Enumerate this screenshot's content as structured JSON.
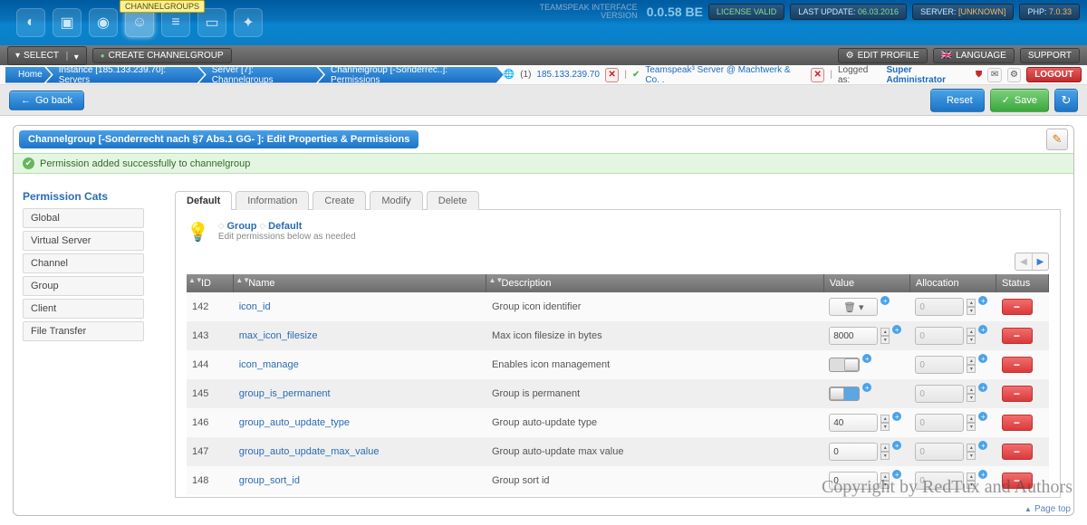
{
  "header": {
    "tooltip": "CHANNELGROUPS",
    "version_label": "TEAMSPEAK INTERFACE\nVERSION",
    "version": "0.0.58 BE",
    "chips": {
      "license": "LICENSE VALID",
      "lastupdate_label": "LAST UPDATE:",
      "lastupdate_value": "06.03.2016",
      "server_label": "SERVER:",
      "server_value": "[UNKNOWN]",
      "php_label": "PHP:",
      "php_value": "7.0.33"
    }
  },
  "secondbar": {
    "select": "SELECT",
    "create_cg": "CREATE CHANNELGROUP",
    "edit_profile": "EDIT PROFILE",
    "language": "LANGUAGE",
    "support": "SUPPORT"
  },
  "breadcrumbs": [
    "Home",
    "Instance [185.133.239.70]: Servers",
    "Server [7]: Channelgroups",
    "Channelgroup [-Sonderrec..]: Permissions"
  ],
  "bc_right": {
    "instance_count": "(1)",
    "instance_ip": "185.133.239.70",
    "server_name": "Teamspeak³ Server @ Machtwerk & Co. .",
    "logged_label": "Logged as:",
    "logged_user": "Super Administrator",
    "logout": "LOGOUT"
  },
  "actionbar": {
    "goback": "Go back",
    "reset": "Reset",
    "save": "Save"
  },
  "card": {
    "title": "Channelgroup [-Sonderrecht nach §7 Abs.1 GG- ]: Edit Properties & Permissions",
    "success": "Permission added successfully to channelgroup"
  },
  "cats": {
    "title": "Permission Cats",
    "items": [
      "Global",
      "Virtual Server",
      "Channel",
      "Group",
      "Client",
      "File Transfer"
    ]
  },
  "tabs": [
    "Default",
    "Information",
    "Create",
    "Modify",
    "Delete"
  ],
  "hint": {
    "title_a": "Group",
    "title_b": "Default",
    "sub": "Edit permissions below as needed"
  },
  "table": {
    "headers": {
      "id": "ID",
      "name": "Name",
      "desc": "Description",
      "value": "Value",
      "alloc": "Allocation",
      "status": "Status"
    },
    "rows": [
      {
        "id": "142",
        "name": "icon_id",
        "desc": "Group icon identifier",
        "vtype": "icon",
        "value": "",
        "alloc": "0"
      },
      {
        "id": "143",
        "name": "max_icon_filesize",
        "desc": "Max icon filesize in bytes",
        "vtype": "num",
        "value": "8000",
        "alloc": "0"
      },
      {
        "id": "144",
        "name": "icon_manage",
        "desc": "Enables icon management",
        "vtype": "toggle",
        "value": "off",
        "alloc": "0"
      },
      {
        "id": "145",
        "name": "group_is_permanent",
        "desc": "Group is permanent",
        "vtype": "toggle",
        "value": "on",
        "alloc": "0"
      },
      {
        "id": "146",
        "name": "group_auto_update_type",
        "desc": "Group auto-update type",
        "vtype": "num",
        "value": "40",
        "alloc": "0"
      },
      {
        "id": "147",
        "name": "group_auto_update_max_value",
        "desc": "Group auto-update max value",
        "vtype": "num",
        "value": "0",
        "alloc": "0"
      },
      {
        "id": "148",
        "name": "group_sort_id",
        "desc": "Group sort id",
        "vtype": "num",
        "value": "0",
        "alloc": "0"
      }
    ]
  },
  "watermark": "Copyright by RedTux and Authors",
  "pagetop": "Page top"
}
